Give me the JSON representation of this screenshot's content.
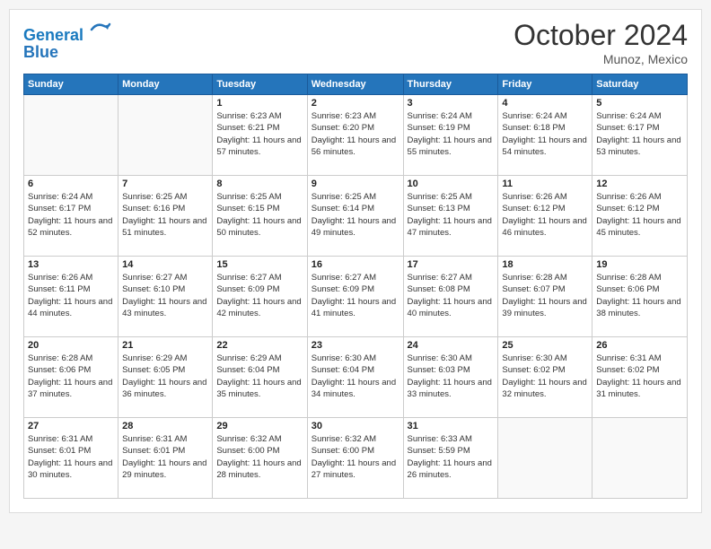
{
  "header": {
    "logo_line1": "General",
    "logo_line2": "Blue",
    "month": "October 2024",
    "location": "Munoz, Mexico"
  },
  "weekdays": [
    "Sunday",
    "Monday",
    "Tuesday",
    "Wednesday",
    "Thursday",
    "Friday",
    "Saturday"
  ],
  "weeks": [
    [
      {
        "day": "",
        "info": ""
      },
      {
        "day": "",
        "info": ""
      },
      {
        "day": "1",
        "info": "Sunrise: 6:23 AM\nSunset: 6:21 PM\nDaylight: 11 hours and 57 minutes."
      },
      {
        "day": "2",
        "info": "Sunrise: 6:23 AM\nSunset: 6:20 PM\nDaylight: 11 hours and 56 minutes."
      },
      {
        "day": "3",
        "info": "Sunrise: 6:24 AM\nSunset: 6:19 PM\nDaylight: 11 hours and 55 minutes."
      },
      {
        "day": "4",
        "info": "Sunrise: 6:24 AM\nSunset: 6:18 PM\nDaylight: 11 hours and 54 minutes."
      },
      {
        "day": "5",
        "info": "Sunrise: 6:24 AM\nSunset: 6:17 PM\nDaylight: 11 hours and 53 minutes."
      }
    ],
    [
      {
        "day": "6",
        "info": "Sunrise: 6:24 AM\nSunset: 6:17 PM\nDaylight: 11 hours and 52 minutes."
      },
      {
        "day": "7",
        "info": "Sunrise: 6:25 AM\nSunset: 6:16 PM\nDaylight: 11 hours and 51 minutes."
      },
      {
        "day": "8",
        "info": "Sunrise: 6:25 AM\nSunset: 6:15 PM\nDaylight: 11 hours and 50 minutes."
      },
      {
        "day": "9",
        "info": "Sunrise: 6:25 AM\nSunset: 6:14 PM\nDaylight: 11 hours and 49 minutes."
      },
      {
        "day": "10",
        "info": "Sunrise: 6:25 AM\nSunset: 6:13 PM\nDaylight: 11 hours and 47 minutes."
      },
      {
        "day": "11",
        "info": "Sunrise: 6:26 AM\nSunset: 6:12 PM\nDaylight: 11 hours and 46 minutes."
      },
      {
        "day": "12",
        "info": "Sunrise: 6:26 AM\nSunset: 6:12 PM\nDaylight: 11 hours and 45 minutes."
      }
    ],
    [
      {
        "day": "13",
        "info": "Sunrise: 6:26 AM\nSunset: 6:11 PM\nDaylight: 11 hours and 44 minutes."
      },
      {
        "day": "14",
        "info": "Sunrise: 6:27 AM\nSunset: 6:10 PM\nDaylight: 11 hours and 43 minutes."
      },
      {
        "day": "15",
        "info": "Sunrise: 6:27 AM\nSunset: 6:09 PM\nDaylight: 11 hours and 42 minutes."
      },
      {
        "day": "16",
        "info": "Sunrise: 6:27 AM\nSunset: 6:09 PM\nDaylight: 11 hours and 41 minutes."
      },
      {
        "day": "17",
        "info": "Sunrise: 6:27 AM\nSunset: 6:08 PM\nDaylight: 11 hours and 40 minutes."
      },
      {
        "day": "18",
        "info": "Sunrise: 6:28 AM\nSunset: 6:07 PM\nDaylight: 11 hours and 39 minutes."
      },
      {
        "day": "19",
        "info": "Sunrise: 6:28 AM\nSunset: 6:06 PM\nDaylight: 11 hours and 38 minutes."
      }
    ],
    [
      {
        "day": "20",
        "info": "Sunrise: 6:28 AM\nSunset: 6:06 PM\nDaylight: 11 hours and 37 minutes."
      },
      {
        "day": "21",
        "info": "Sunrise: 6:29 AM\nSunset: 6:05 PM\nDaylight: 11 hours and 36 minutes."
      },
      {
        "day": "22",
        "info": "Sunrise: 6:29 AM\nSunset: 6:04 PM\nDaylight: 11 hours and 35 minutes."
      },
      {
        "day": "23",
        "info": "Sunrise: 6:30 AM\nSunset: 6:04 PM\nDaylight: 11 hours and 34 minutes."
      },
      {
        "day": "24",
        "info": "Sunrise: 6:30 AM\nSunset: 6:03 PM\nDaylight: 11 hours and 33 minutes."
      },
      {
        "day": "25",
        "info": "Sunrise: 6:30 AM\nSunset: 6:02 PM\nDaylight: 11 hours and 32 minutes."
      },
      {
        "day": "26",
        "info": "Sunrise: 6:31 AM\nSunset: 6:02 PM\nDaylight: 11 hours and 31 minutes."
      }
    ],
    [
      {
        "day": "27",
        "info": "Sunrise: 6:31 AM\nSunset: 6:01 PM\nDaylight: 11 hours and 30 minutes."
      },
      {
        "day": "28",
        "info": "Sunrise: 6:31 AM\nSunset: 6:01 PM\nDaylight: 11 hours and 29 minutes."
      },
      {
        "day": "29",
        "info": "Sunrise: 6:32 AM\nSunset: 6:00 PM\nDaylight: 11 hours and 28 minutes."
      },
      {
        "day": "30",
        "info": "Sunrise: 6:32 AM\nSunset: 6:00 PM\nDaylight: 11 hours and 27 minutes."
      },
      {
        "day": "31",
        "info": "Sunrise: 6:33 AM\nSunset: 5:59 PM\nDaylight: 11 hours and 26 minutes."
      },
      {
        "day": "",
        "info": ""
      },
      {
        "day": "",
        "info": ""
      }
    ]
  ]
}
